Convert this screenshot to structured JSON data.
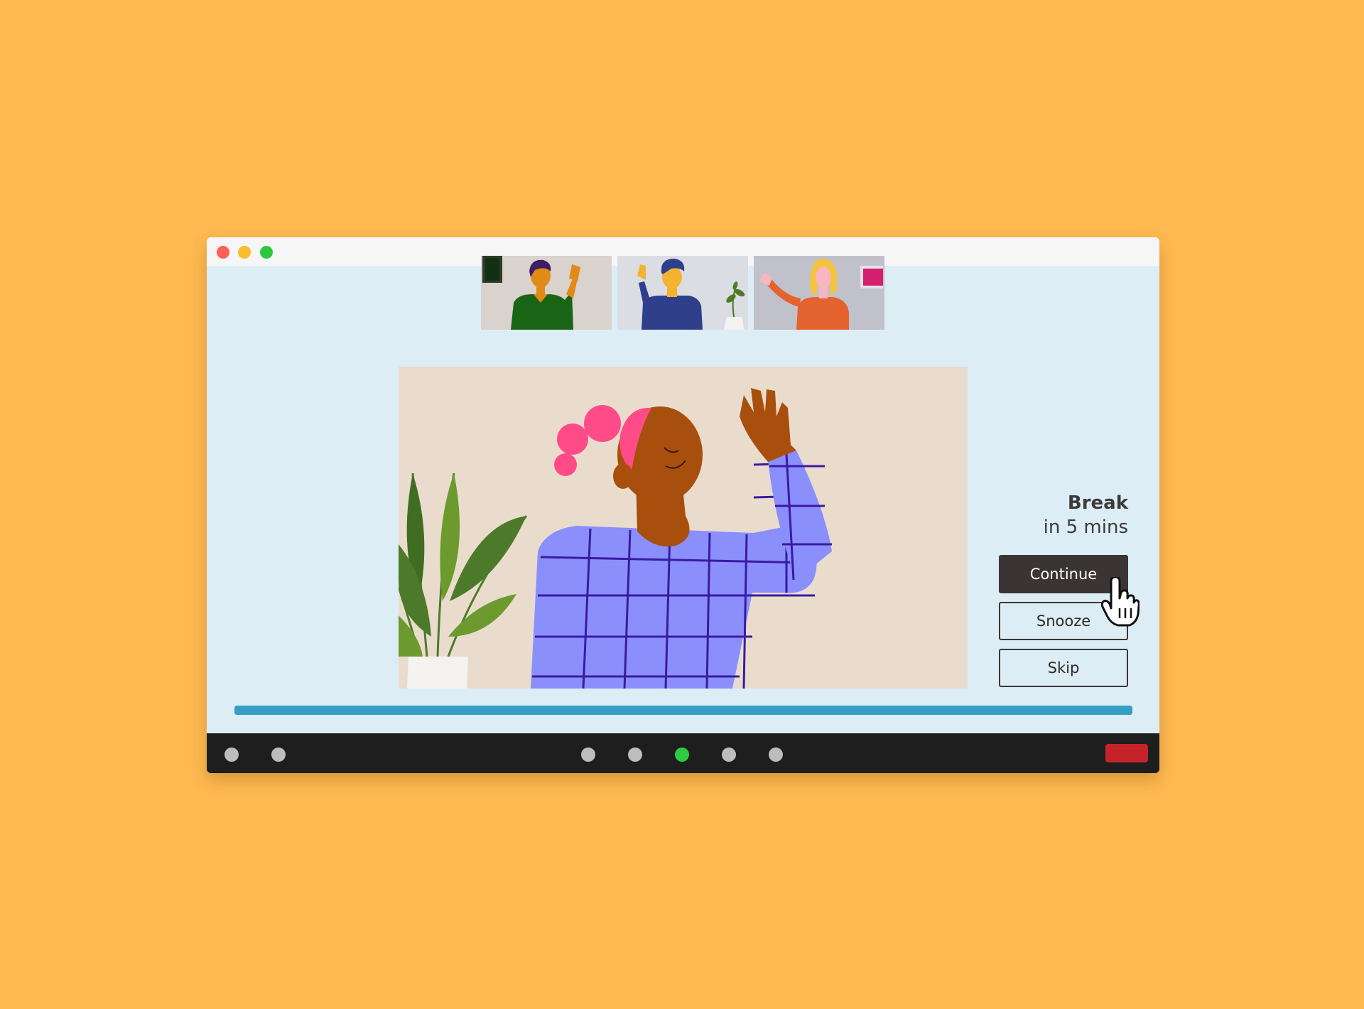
{
  "window": {
    "controls": [
      "close",
      "minimize",
      "maximize"
    ]
  },
  "participants": [
    {
      "name": "participant-1",
      "shirt_color": "#1A6515",
      "background": "#D9D2CD"
    },
    {
      "name": "participant-2",
      "shirt_color": "#2F3F8C",
      "background": "#DADDE2"
    },
    {
      "name": "participant-3",
      "shirt_color": "#E4622D",
      "background": "#C1C1CC"
    }
  ],
  "main_video": {
    "background": "#EADCCC",
    "shirt_color": "#8A8FFC",
    "grid_color": "#3A1AA3",
    "hair_color": "#FF4B88"
  },
  "break_panel": {
    "title": "Break",
    "subtitle": "in 5 mins",
    "buttons": {
      "continue": "Continue",
      "snooze": "Snooze",
      "skip": "Skip"
    }
  },
  "progress": {
    "value_percent": 100,
    "color": "#369EC4"
  },
  "toolbar": {
    "left_buttons": [
      "control-1",
      "control-2"
    ],
    "center_buttons": [
      {
        "name": "control-3",
        "color": "#BDBDBD"
      },
      {
        "name": "control-4",
        "color": "#BDBDBD"
      },
      {
        "name": "control-5",
        "color": "#2ECC40",
        "active": true
      },
      {
        "name": "control-6",
        "color": "#BDBDBD"
      },
      {
        "name": "control-7",
        "color": "#BDBDBD"
      }
    ],
    "end_call_color": "#C4232A"
  },
  "colors": {
    "page_background": "#FEB951",
    "window_background": "#DDEDF5",
    "toolbar_background": "#1E1E1E",
    "primary_button": "#3B3434"
  }
}
